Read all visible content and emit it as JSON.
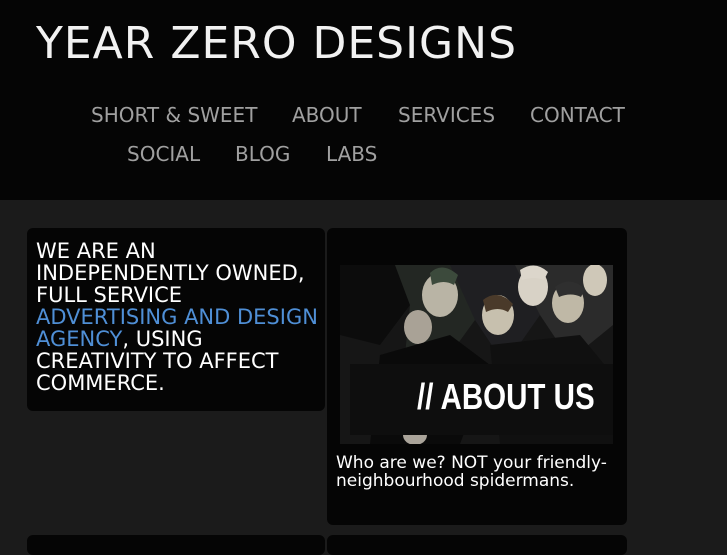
{
  "site": {
    "title": "YEAR ZERO DESIGNS"
  },
  "nav": {
    "items": [
      {
        "label": "SHORT & SWEET"
      },
      {
        "label": "ABOUT"
      },
      {
        "label": "SERVICES"
      },
      {
        "label": "CONTACT"
      },
      {
        "label": "SOCIAL"
      },
      {
        "label": "BLOG"
      },
      {
        "label": "LABS"
      }
    ]
  },
  "intro": {
    "text_before": "WE ARE AN INDEPENDENTLY OWNED, FULL SERVICE ",
    "link": "ADVERTISING AND DESIGN AGENCY",
    "text_after": ", USING CREATIVITY TO AFFECT COMMERCE."
  },
  "about_card": {
    "image_label": "// ABOUT US",
    "caption": "Who are we? NOT your friendly-neighbourhood spidermans."
  },
  "colors": {
    "link": "#4f8fd6",
    "nav": "#a0a0a0",
    "header_bg": "#050505",
    "body_bg": "#1b1b1b"
  }
}
